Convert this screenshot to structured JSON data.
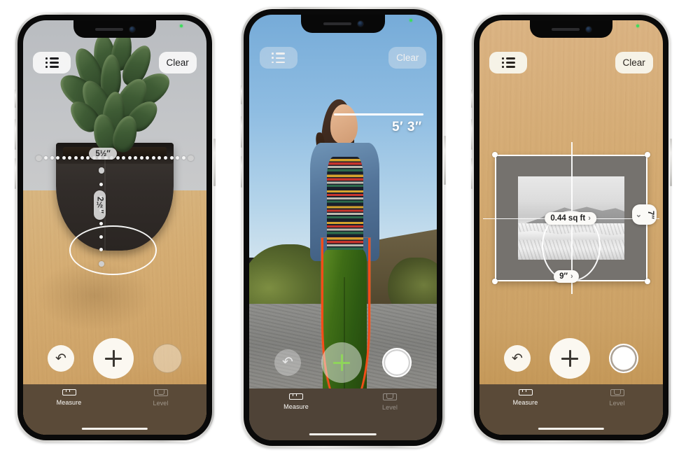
{
  "app": {
    "name": "Measure",
    "tabs": [
      {
        "label": "Measure",
        "icon": "ruler-icon",
        "active": true
      },
      {
        "label": "Level",
        "icon": "level-icon",
        "active": false
      }
    ]
  },
  "colors": {
    "accent_green": "#3ddc5c",
    "wood": "#d4ab74",
    "tabbar": "#5a4a38",
    "chip_bg": "#e1e1e1",
    "white": "#ffffff"
  },
  "phones": [
    {
      "id": "phone-measure-object",
      "scene": "succulent-plant-on-wooden-table",
      "toolbar": {
        "list_label": "history-list",
        "clear_label": "Clear"
      },
      "controls": {
        "undo_label": "undo",
        "add_label": "add-point",
        "shutter_label": "capture"
      },
      "measurements": [
        {
          "value": "5½″",
          "orientation": "horizontal",
          "name": "width-measurement"
        },
        {
          "value": "2½″",
          "orientation": "vertical",
          "name": "height-measurement"
        }
      ]
    },
    {
      "id": "phone-measure-person",
      "scene": "person-standing-outdoors-with-jump-rope",
      "toolbar": {
        "list_label": "history-list",
        "clear_label": "Clear"
      },
      "controls": {
        "undo_label": "undo",
        "add_label": "add-point",
        "shutter_label": "capture"
      },
      "measurements": [
        {
          "value": "5′ 3″",
          "orientation": "horizontal",
          "name": "person-height-measurement"
        }
      ]
    },
    {
      "id": "phone-measure-area",
      "scene": "framed-landscape-photo-on-wooden-wall",
      "toolbar": {
        "list_label": "history-list",
        "clear_label": "Clear"
      },
      "controls": {
        "undo_label": "undo",
        "add_label": "add-point",
        "shutter_label": "capture"
      },
      "measurements": [
        {
          "value": "0.44 sq ft",
          "orientation": "area",
          "name": "area-measurement",
          "chevron": "›"
        },
        {
          "value": "7″",
          "orientation": "vertical",
          "name": "height-measurement",
          "chevron": "⌄"
        },
        {
          "value": "9″",
          "orientation": "horizontal",
          "name": "width-measurement",
          "chevron": "›"
        }
      ]
    }
  ]
}
